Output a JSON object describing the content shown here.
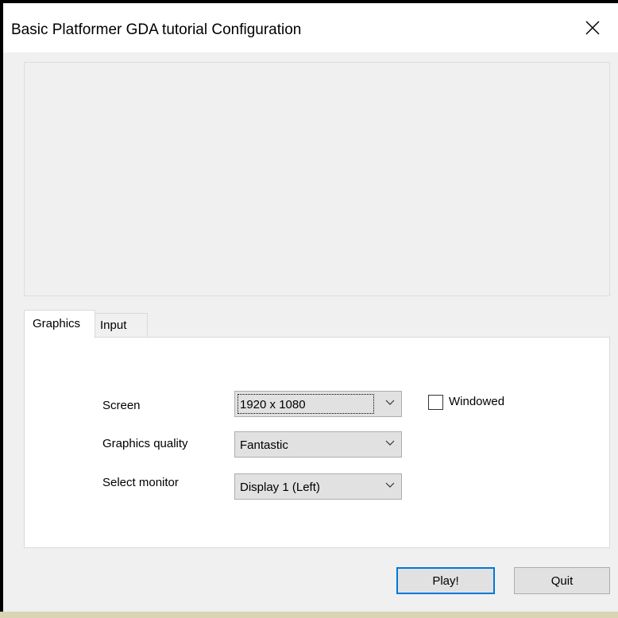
{
  "window": {
    "title": "Basic Platformer GDA tutorial Configuration",
    "close_icon": "close-icon"
  },
  "tabs": [
    {
      "label": "Graphics",
      "active": true
    },
    {
      "label": "Input",
      "active": false
    }
  ],
  "graphics": {
    "screen_label": "Screen",
    "screen_value": "1920 x 1080",
    "quality_label": "Graphics quality",
    "quality_value": "Fantastic",
    "monitor_label": "Select monitor",
    "monitor_value": "Display 1 (Left)",
    "windowed_label": "Windowed",
    "windowed_checked": false
  },
  "buttons": {
    "play_label": "Play!",
    "quit_label": "Quit"
  },
  "colors": {
    "accent": "#0078d7"
  }
}
